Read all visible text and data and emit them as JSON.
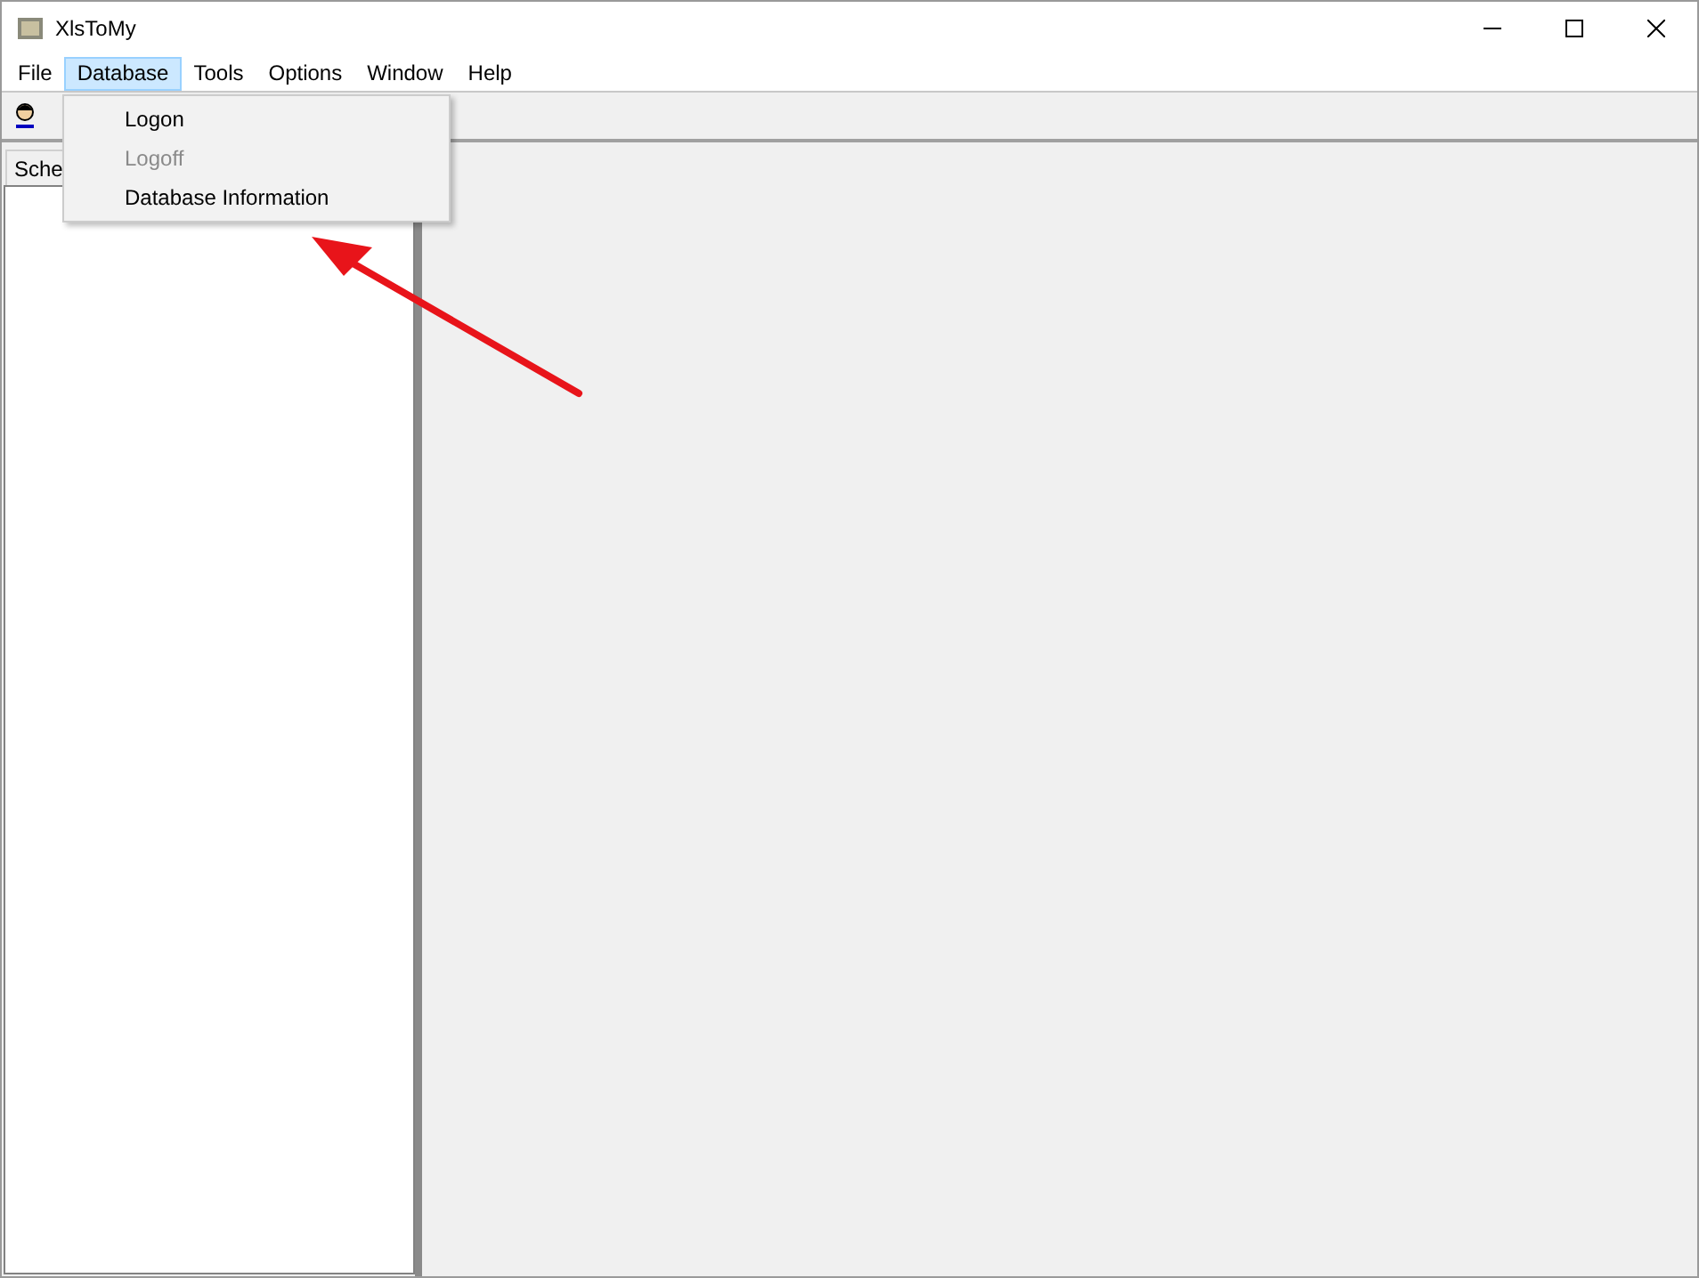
{
  "window": {
    "title": "XlsToMy"
  },
  "menu_bar": [
    {
      "label": "File",
      "selected": false
    },
    {
      "label": "Database",
      "selected": true
    },
    {
      "label": "Tools",
      "selected": false
    },
    {
      "label": "Options",
      "selected": false
    },
    {
      "label": "Window",
      "selected": false
    },
    {
      "label": "Help",
      "selected": false
    }
  ],
  "dropdown": [
    {
      "label": "Logon",
      "disabled": false
    },
    {
      "label": "Logoff",
      "disabled": true
    },
    {
      "label": "Database Information",
      "disabled": false
    }
  ],
  "left_panel": {
    "tab": "Sche"
  }
}
